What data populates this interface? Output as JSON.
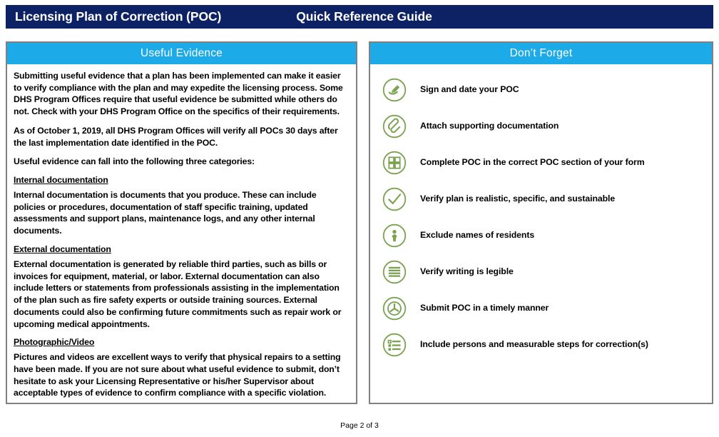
{
  "banner": {
    "title": "Licensing Plan of Correction (POC)",
    "subtitle": "Quick Reference Guide",
    "background_color": "#0d2265",
    "text_color": "#ffffff"
  },
  "panels": {
    "accent_color": "#1cabe8",
    "border_color": "#808080",
    "left": {
      "heading": "Useful Evidence",
      "paragraphs": [
        "Submitting useful evidence that a plan has been implemented can make it easier to verify compliance with the plan and may expedite the licensing process. Some DHS Program Offices require that useful evidence be submitted while others do not. Check with your DHS Program Office on the specifics of their requirements.",
        "As of October 1, 2019, all DHS Program Offices will verify all POCs 30 days after the last implementation date identified in the POC.",
        "Useful evidence can fall into the following three categories:"
      ],
      "sections": [
        {
          "subhead": "Internal documentation",
          "body": "Internal documentation is documents that you produce. These can include policies or procedures, documentation of staff specific training, updated assessments and support plans, maintenance logs, and any other internal documents."
        },
        {
          "subhead": "External documentation",
          "body": "External documentation is generated by reliable third parties, such as bills or invoices for equipment, material, or labor. External documentation can also include letters or statements from professionals assisting in the implementation of the plan such as fire safety experts or outside training sources. External documents could also be confirming future commitments such as repair work or upcoming medical appointments."
        },
        {
          "subhead": "Photographic/Video",
          "body": "Pictures and videos are excellent ways to verify that physical repairs to a setting have been made. If you are not sure about what useful evidence to submit, don’t hesitate to ask your Licensing Representative or his/her Supervisor about acceptable types of evidence to confirm compliance with a specific violation."
        }
      ]
    },
    "right": {
      "heading": "Don’t Forget",
      "icon_color": "#7ba250",
      "items": [
        {
          "icon": "pen-signature-icon",
          "label": "Sign and date your POC"
        },
        {
          "icon": "paperclip-icon",
          "label": "Attach supporting documentation"
        },
        {
          "icon": "grid-squares-icon",
          "label": "Complete POC in the correct POC section of your form"
        },
        {
          "icon": "check-circle-icon",
          "label": "Verify plan is realistic, specific, and sustainable"
        },
        {
          "icon": "person-icon",
          "label": "Exclude names of residents"
        },
        {
          "icon": "lines-document-icon",
          "label": "Verify writing is legible"
        },
        {
          "icon": "clock-icon",
          "label": "Submit POC in a timely manner"
        },
        {
          "icon": "checklist-icon",
          "label": "Include persons and measurable steps for correction(s)"
        }
      ]
    }
  },
  "footer": {
    "page_label": "Page 2 of 3"
  }
}
